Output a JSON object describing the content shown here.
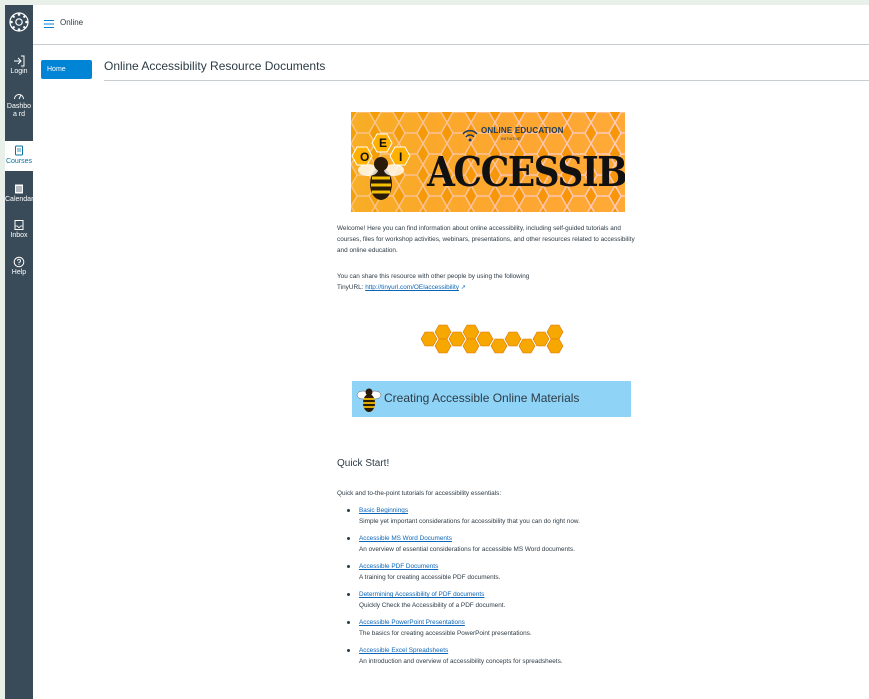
{
  "nav": {
    "items": [
      {
        "id": "login",
        "label": "Login",
        "icon": "login-icon"
      },
      {
        "id": "dashboard",
        "label": "Dashboa rd",
        "icon": "dashboard-icon"
      },
      {
        "id": "courses",
        "label": "Courses",
        "icon": "courses-icon",
        "active": true
      },
      {
        "id": "calendar",
        "label": "Calendar",
        "icon": "calendar-icon"
      },
      {
        "id": "inbox",
        "label": "Inbox",
        "icon": "inbox-icon"
      },
      {
        "id": "help",
        "label": "Help",
        "icon": "help-icon"
      }
    ]
  },
  "header": {
    "breadcrumb": "Online"
  },
  "course_nav": {
    "home_label": "Home"
  },
  "page": {
    "title": "Online Accessibility Resource Documents",
    "banner": {
      "org": "ONLINE EDUCATION",
      "org_sub": "INITIATIVE",
      "headline": "ACCESSIBILITY",
      "oei_letters": [
        "O",
        "E",
        "I"
      ]
    },
    "welcome": "Welcome! Here you can find information about online accessibility, including self-guided tutorials and courses, files for workshop activities, webinars, presentations, and other resources related to accessibility and online education.",
    "share_text": "You can share this resource with other people by using the following TinyURL:",
    "share_link": "http://tinyurl.com/OEIaccessibility",
    "section_banner": "Creating Accessible Online Materials",
    "quick_heading": "Quick Start!",
    "quick_intro": "Quick and to-the-point tutorials for accessibility essentials:",
    "links": [
      {
        "title": "Basic Beginnings",
        "desc": "Simple yet important considerations for accessibility that you can do right now."
      },
      {
        "title": "Accessible MS Word Documents",
        "desc": "An overview of essential considerations for accessible MS Word documents."
      },
      {
        "title": "Accessible PDF Documents",
        "desc": "A training for creating accessible PDF documents."
      },
      {
        "title": "Determining Accessibility of PDF documents",
        "desc": "Quickly Check the Accessibility of a PDF document."
      },
      {
        "title": "Accessible PowerPoint Presentations",
        "desc": "The basics for creating accessible PowerPoint presentations."
      },
      {
        "title": "Accessible Excel Spreadsheets",
        "desc": "An introduction and overview of accessibility concepts for spreadsheets."
      }
    ]
  },
  "colors": {
    "nav_bg": "#394b58",
    "accent": "#0084d6",
    "link": "#0b66b8",
    "honey": "#f6b80d",
    "section_blue": "#8fd3f7"
  }
}
